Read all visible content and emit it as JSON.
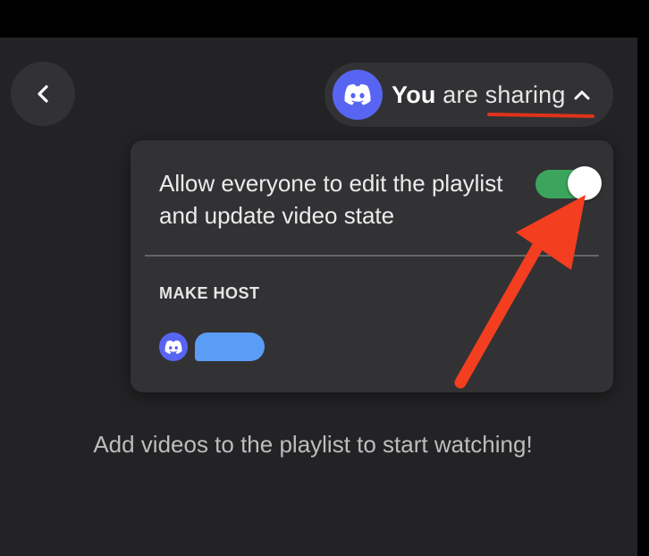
{
  "header": {
    "back_icon": "chevron-left-icon",
    "share_pill": {
      "avatar_icon": "discord-logo-icon",
      "label_strong": "You",
      "label_rest": " are sharing",
      "chevron_icon": "chevron-up-icon"
    }
  },
  "panel": {
    "setting_text": "Allow everyone to edit the playlist and update video state",
    "toggle_on": true,
    "section_title": "MAKE HOST",
    "host_candidates": [
      {
        "avatar_icon": "discord-logo-icon"
      }
    ]
  },
  "main": {
    "empty_message": "Add videos to the playlist to start watching!"
  },
  "annotations": {
    "arrow_color": "#f33e1f",
    "underline_color": "#e0321c"
  },
  "colors": {
    "background": "#232325",
    "surface": "#323235",
    "toggle_on": "#3ba55d",
    "discord_blurple": "#5865f2",
    "redaction": "#5b9cf5"
  }
}
